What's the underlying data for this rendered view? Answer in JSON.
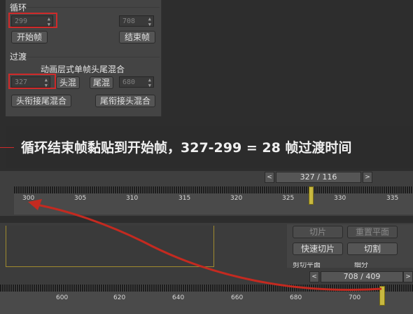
{
  "loop": {
    "title": "循环",
    "start_value": "299",
    "end_value": "708",
    "start_button": "开始帧",
    "end_button": "结束帧"
  },
  "transition": {
    "title": "过渡",
    "subtitle": "动画层式单帧头尾混合",
    "value": "327",
    "head_mix_button": "头混",
    "tail_mix_button": "尾混",
    "tail_value": "680",
    "head_to_tail_button": "头衔接尾混合",
    "tail_to_head_button": "尾衔接头混合"
  },
  "annotation": {
    "text": "循环结束帧黏贴到开始帧，327-299 = 28 帧过渡时间",
    "color": "#d02a2a"
  },
  "timeline1": {
    "slider_label": "327 / 116",
    "prev_arrow": "<",
    "next_arrow": ">",
    "tick_labels": [
      "300",
      "305",
      "310",
      "315",
      "320",
      "325",
      "330",
      "335"
    ],
    "current_frame": 327
  },
  "lower_panel": {
    "cut_button": "切片",
    "reset_plane_button": "重置平面",
    "quick_cut_button": "快速切片",
    "slice_button": "切割",
    "partial1": "剪切平面",
    "partial2": "细分"
  },
  "timeline2": {
    "slider_label": "708 / 409",
    "prev_arrow": "<",
    "next_arrow": ">",
    "tick_labels": [
      "600",
      "620",
      "640",
      "660",
      "680",
      "700"
    ],
    "current_frame": 708
  },
  "colors": {
    "accent_red": "#d02a2a",
    "frame_marker": "#c8b840",
    "panel_bg": "#444444"
  }
}
